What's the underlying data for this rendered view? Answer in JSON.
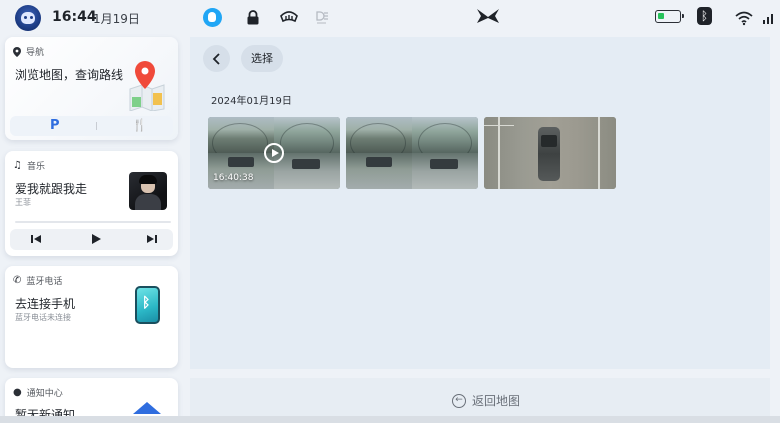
{
  "status_bar": {
    "time": "16:44",
    "date": "1月19日",
    "icons": [
      "avatar-icon",
      "voice-assistant-icon",
      "lock-icon",
      "defrost-icon",
      "light-icon",
      "brand-logo-icon",
      "battery-icon",
      "bluetooth-icon",
      "wifi-icon"
    ],
    "battery_level": 0.3
  },
  "cards": {
    "navigation": {
      "header": "导航",
      "title": "浏览地图，查询路线",
      "shortcut_parking": "P",
      "shortcut_food": "🍴"
    },
    "music": {
      "header": "音乐",
      "song": "爱我就跟我走",
      "artist": "王菲",
      "progress": 0.0
    },
    "phone": {
      "header": "蓝牙电话",
      "title": "去连接手机",
      "subtitle": "蓝牙电话未连接"
    },
    "notifications": {
      "header": "通知中心",
      "title": "暂无新通知"
    }
  },
  "gallery": {
    "back_label": "‹",
    "select_label": "选择",
    "date_group": "2024年01月19日",
    "items": [
      {
        "type": "video",
        "duration": "16:40:38"
      },
      {
        "type": "image"
      },
      {
        "type": "image"
      }
    ]
  },
  "footer": {
    "return_label": "返回地图"
  },
  "colors": {
    "accent_blue": "#2f6ddf",
    "background": "#eef2f7",
    "panel": "#e4ecf4",
    "battery_green": "#26c25a"
  }
}
